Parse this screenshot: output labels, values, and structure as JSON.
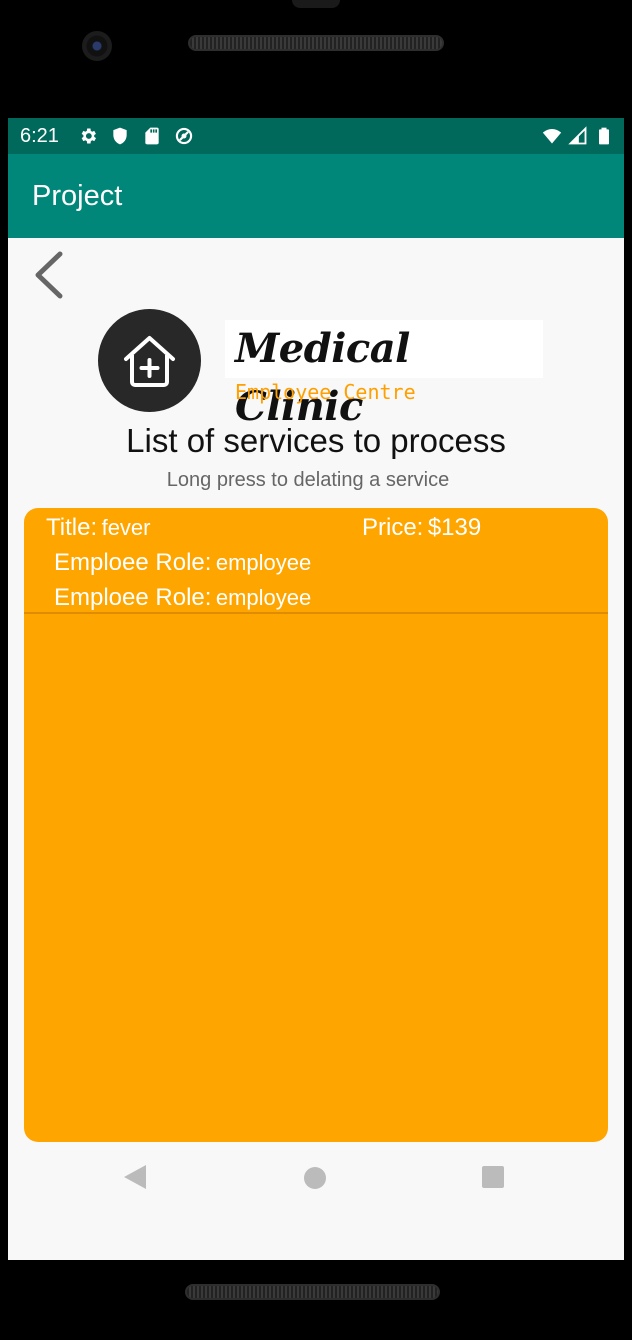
{
  "status_bar": {
    "time": "6:21",
    "icons_left": [
      "gear-icon",
      "shield-icon",
      "sd-card-icon",
      "no-sync-icon"
    ],
    "icons_right": [
      "wifi-icon",
      "signal-icon",
      "battery-icon"
    ]
  },
  "app_bar": {
    "title": "Project",
    "color": "#00877a"
  },
  "header": {
    "logo_text": "Medical Clinic",
    "logo_subtitle": "Employee Centre",
    "heading": "List of services to process",
    "hint": "Long press to delating a service"
  },
  "services": [
    {
      "title_label": "Title:",
      "title_value": "fever",
      "price_label": "Price:",
      "price_value": "$139",
      "role_label_1": "Emploee Role:",
      "role_value_1": "employee",
      "role_label_2": "Emploee Role:",
      "role_value_2": "employee"
    }
  ],
  "colors": {
    "status_bar": "#00695c",
    "accent": "#ffa500",
    "logo_subtitle": "#ffa000"
  },
  "nav_bar": {
    "buttons": [
      "back-icon",
      "home-icon",
      "recents-icon"
    ]
  }
}
